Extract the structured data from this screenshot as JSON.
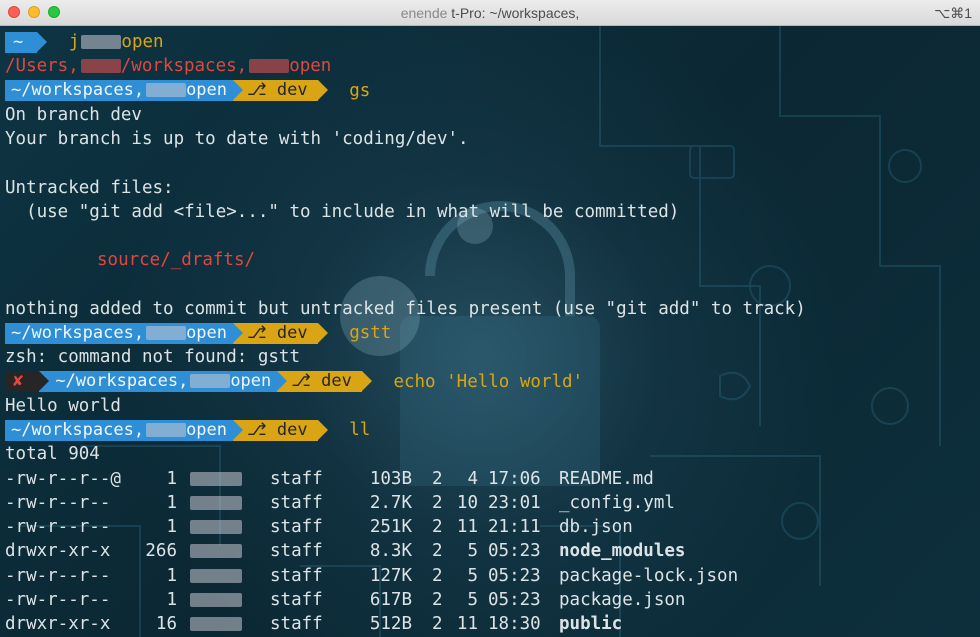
{
  "window": {
    "title": "t-Pro: ~/workspaces,",
    "title_prefix": "enende",
    "shortcut": "⌥⌘1"
  },
  "colors": {
    "path_segment": "#2e8fd6",
    "git_segment": "#d9a514",
    "error_text": "#e0473d",
    "output_text": "#dce3e6"
  },
  "terminal": {
    "line1": {
      "tilde": "~",
      "cmd_a": "j",
      "cmd_b": "open"
    },
    "line2": {
      "a": "/Users,",
      "b": "/workspaces,",
      "c": "open"
    },
    "line3": {
      "path": "~/workspaces,",
      "path_tail": "open",
      "branch_icon": "branch-icon",
      "branch": "dev",
      "cmd": "gs"
    },
    "line4": "On branch dev",
    "line5": "Your branch is up to date with 'coding/dev'.",
    "line7": "Untracked files:",
    "line8": "  (use \"git add <file>...\" to include in what will be committed)",
    "line10": "source/_drafts/",
    "line12": "nothing added to commit but untracked files present (use \"git add\" to track)",
    "line13": {
      "path": "~/workspaces,",
      "path_tail": "open",
      "branch": "dev",
      "cmd": "gstt"
    },
    "line14": "zsh: command not found: gstt",
    "line15": {
      "error_mark": "✘",
      "path": "~/workspaces,",
      "path_tail": "open",
      "branch": "dev",
      "cmd": "echo 'Hello world'"
    },
    "line16": "Hello world",
    "line17": {
      "path": "~/workspaces,",
      "path_tail": "open",
      "branch": "dev",
      "cmd": "ll"
    },
    "line18": "total 904",
    "listing": [
      {
        "perms": "-rw-r--r--@",
        "links": "1",
        "group": "staff",
        "size": "103B",
        "month": "2",
        "day": "4",
        "time": "17:06",
        "name": "README.md",
        "bold": false
      },
      {
        "perms": "-rw-r--r--",
        "links": "1",
        "group": "staff",
        "size": "2.7K",
        "month": "2",
        "day": "10",
        "time": "23:01",
        "name": "_config.yml",
        "bold": false
      },
      {
        "perms": "-rw-r--r--",
        "links": "1",
        "group": "staff",
        "size": "251K",
        "month": "2",
        "day": "11",
        "time": "21:11",
        "name": "db.json",
        "bold": false
      },
      {
        "perms": "drwxr-xr-x",
        "links": "266",
        "group": "staff",
        "size": "8.3K",
        "month": "2",
        "day": "5",
        "time": "05:23",
        "name": "node_modules",
        "bold": true
      },
      {
        "perms": "-rw-r--r--",
        "links": "1",
        "group": "staff",
        "size": "127K",
        "month": "2",
        "day": "5",
        "time": "05:23",
        "name": "package-lock.json",
        "bold": false
      },
      {
        "perms": "-rw-r--r--",
        "links": "1",
        "group": "staff",
        "size": "617B",
        "month": "2",
        "day": "5",
        "time": "05:23",
        "name": "package.json",
        "bold": false
      },
      {
        "perms": "drwxr-xr-x",
        "links": "16",
        "group": "staff",
        "size": "512B",
        "month": "2",
        "day": "11",
        "time": "18:30",
        "name": "public",
        "bold": true
      }
    ]
  }
}
